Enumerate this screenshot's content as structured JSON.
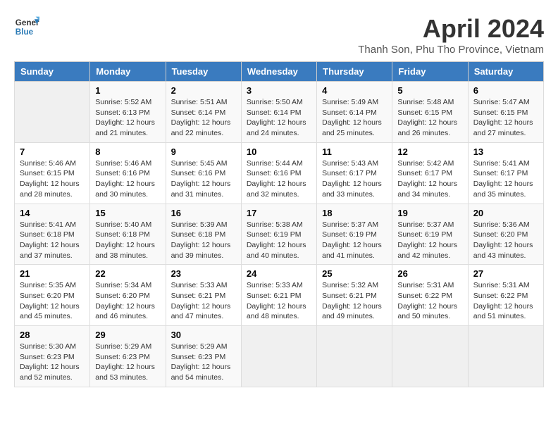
{
  "header": {
    "logo_line1": "General",
    "logo_line2": "Blue",
    "title": "April 2024",
    "subtitle": "Thanh Son, Phu Tho Province, Vietnam"
  },
  "days_of_week": [
    "Sunday",
    "Monday",
    "Tuesday",
    "Wednesday",
    "Thursday",
    "Friday",
    "Saturday"
  ],
  "weeks": [
    [
      {
        "num": "",
        "detail": ""
      },
      {
        "num": "1",
        "detail": "Sunrise: 5:52 AM\nSunset: 6:13 PM\nDaylight: 12 hours\nand 21 minutes."
      },
      {
        "num": "2",
        "detail": "Sunrise: 5:51 AM\nSunset: 6:14 PM\nDaylight: 12 hours\nand 22 minutes."
      },
      {
        "num": "3",
        "detail": "Sunrise: 5:50 AM\nSunset: 6:14 PM\nDaylight: 12 hours\nand 24 minutes."
      },
      {
        "num": "4",
        "detail": "Sunrise: 5:49 AM\nSunset: 6:14 PM\nDaylight: 12 hours\nand 25 minutes."
      },
      {
        "num": "5",
        "detail": "Sunrise: 5:48 AM\nSunset: 6:15 PM\nDaylight: 12 hours\nand 26 minutes."
      },
      {
        "num": "6",
        "detail": "Sunrise: 5:47 AM\nSunset: 6:15 PM\nDaylight: 12 hours\nand 27 minutes."
      }
    ],
    [
      {
        "num": "7",
        "detail": "Sunrise: 5:46 AM\nSunset: 6:15 PM\nDaylight: 12 hours\nand 28 minutes."
      },
      {
        "num": "8",
        "detail": "Sunrise: 5:46 AM\nSunset: 6:16 PM\nDaylight: 12 hours\nand 30 minutes."
      },
      {
        "num": "9",
        "detail": "Sunrise: 5:45 AM\nSunset: 6:16 PM\nDaylight: 12 hours\nand 31 minutes."
      },
      {
        "num": "10",
        "detail": "Sunrise: 5:44 AM\nSunset: 6:16 PM\nDaylight: 12 hours\nand 32 minutes."
      },
      {
        "num": "11",
        "detail": "Sunrise: 5:43 AM\nSunset: 6:17 PM\nDaylight: 12 hours\nand 33 minutes."
      },
      {
        "num": "12",
        "detail": "Sunrise: 5:42 AM\nSunset: 6:17 PM\nDaylight: 12 hours\nand 34 minutes."
      },
      {
        "num": "13",
        "detail": "Sunrise: 5:41 AM\nSunset: 6:17 PM\nDaylight: 12 hours\nand 35 minutes."
      }
    ],
    [
      {
        "num": "14",
        "detail": "Sunrise: 5:41 AM\nSunset: 6:18 PM\nDaylight: 12 hours\nand 37 minutes."
      },
      {
        "num": "15",
        "detail": "Sunrise: 5:40 AM\nSunset: 6:18 PM\nDaylight: 12 hours\nand 38 minutes."
      },
      {
        "num": "16",
        "detail": "Sunrise: 5:39 AM\nSunset: 6:18 PM\nDaylight: 12 hours\nand 39 minutes."
      },
      {
        "num": "17",
        "detail": "Sunrise: 5:38 AM\nSunset: 6:19 PM\nDaylight: 12 hours\nand 40 minutes."
      },
      {
        "num": "18",
        "detail": "Sunrise: 5:37 AM\nSunset: 6:19 PM\nDaylight: 12 hours\nand 41 minutes."
      },
      {
        "num": "19",
        "detail": "Sunrise: 5:37 AM\nSunset: 6:19 PM\nDaylight: 12 hours\nand 42 minutes."
      },
      {
        "num": "20",
        "detail": "Sunrise: 5:36 AM\nSunset: 6:20 PM\nDaylight: 12 hours\nand 43 minutes."
      }
    ],
    [
      {
        "num": "21",
        "detail": "Sunrise: 5:35 AM\nSunset: 6:20 PM\nDaylight: 12 hours\nand 45 minutes."
      },
      {
        "num": "22",
        "detail": "Sunrise: 5:34 AM\nSunset: 6:20 PM\nDaylight: 12 hours\nand 46 minutes."
      },
      {
        "num": "23",
        "detail": "Sunrise: 5:33 AM\nSunset: 6:21 PM\nDaylight: 12 hours\nand 47 minutes."
      },
      {
        "num": "24",
        "detail": "Sunrise: 5:33 AM\nSunset: 6:21 PM\nDaylight: 12 hours\nand 48 minutes."
      },
      {
        "num": "25",
        "detail": "Sunrise: 5:32 AM\nSunset: 6:21 PM\nDaylight: 12 hours\nand 49 minutes."
      },
      {
        "num": "26",
        "detail": "Sunrise: 5:31 AM\nSunset: 6:22 PM\nDaylight: 12 hours\nand 50 minutes."
      },
      {
        "num": "27",
        "detail": "Sunrise: 5:31 AM\nSunset: 6:22 PM\nDaylight: 12 hours\nand 51 minutes."
      }
    ],
    [
      {
        "num": "28",
        "detail": "Sunrise: 5:30 AM\nSunset: 6:23 PM\nDaylight: 12 hours\nand 52 minutes."
      },
      {
        "num": "29",
        "detail": "Sunrise: 5:29 AM\nSunset: 6:23 PM\nDaylight: 12 hours\nand 53 minutes."
      },
      {
        "num": "30",
        "detail": "Sunrise: 5:29 AM\nSunset: 6:23 PM\nDaylight: 12 hours\nand 54 minutes."
      },
      {
        "num": "",
        "detail": ""
      },
      {
        "num": "",
        "detail": ""
      },
      {
        "num": "",
        "detail": ""
      },
      {
        "num": "",
        "detail": ""
      }
    ]
  ]
}
